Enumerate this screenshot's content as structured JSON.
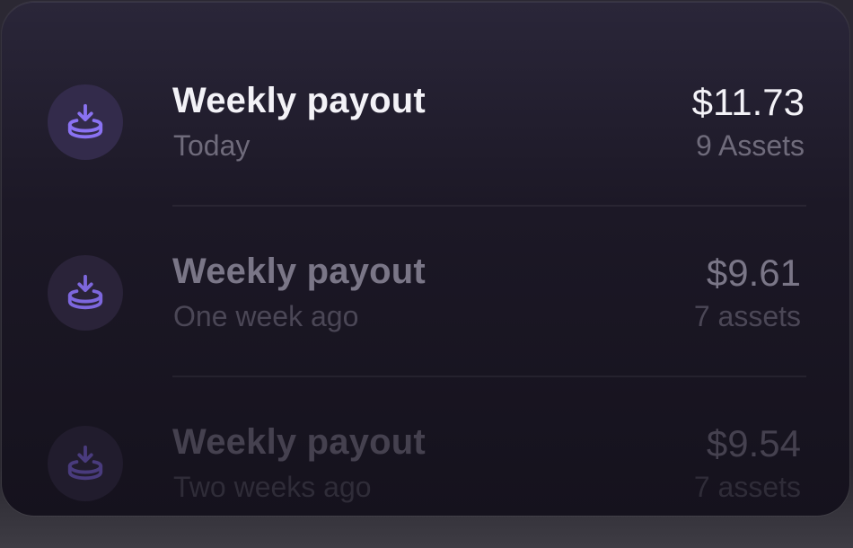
{
  "payouts": [
    {
      "title": "Weekly payout",
      "subtitle": "Today",
      "amount": "$11.73",
      "count": "9 Assets",
      "icon": "download-stack-icon"
    },
    {
      "title": "Weekly payout",
      "subtitle": "One week ago",
      "amount": "$9.61",
      "count": "7 assets",
      "icon": "download-stack-icon"
    },
    {
      "title": "Weekly payout",
      "subtitle": "Two weeks ago",
      "amount": "$9.54",
      "count": "7 assets",
      "icon": "download-stack-icon"
    }
  ],
  "colors": {
    "accent": "#8a72f2",
    "icon_bg": "#332b4b",
    "card_bg": "#1c1826",
    "text_primary": "#f3f2f7",
    "text_secondary": "#6f6b7b"
  }
}
